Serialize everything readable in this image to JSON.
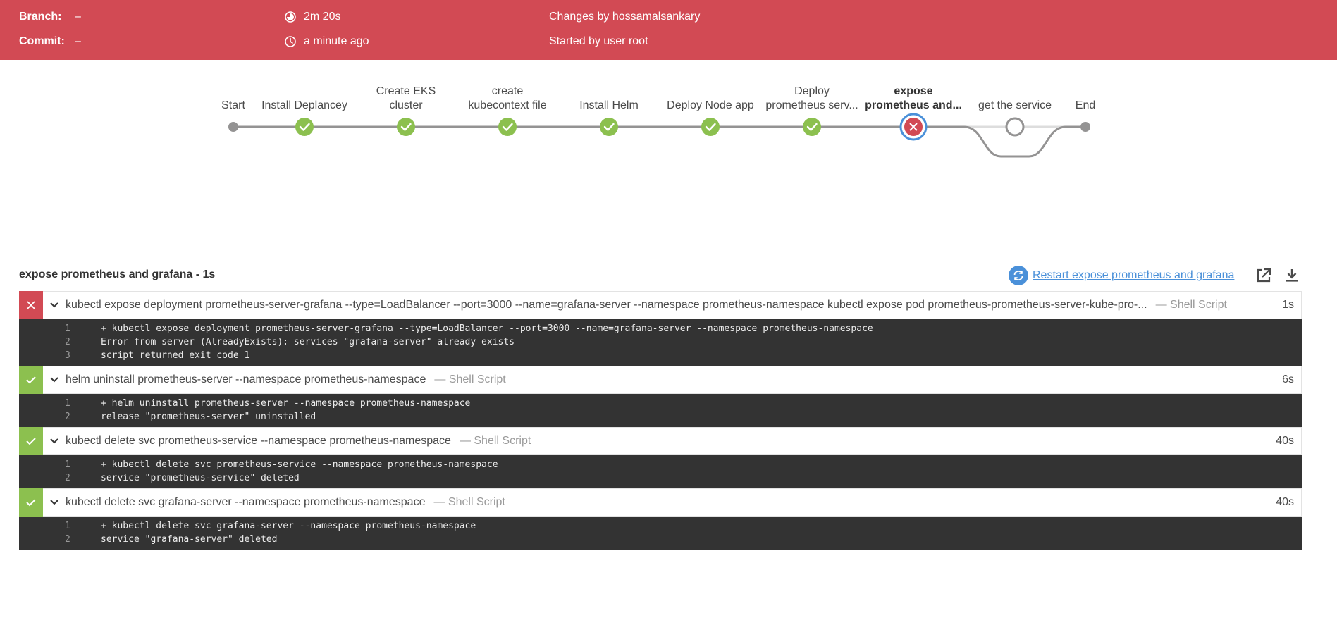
{
  "header": {
    "branch_label": "Branch:",
    "branch_value": "–",
    "commit_label": "Commit:",
    "commit_value": "–",
    "duration": "2m 20s",
    "started_ago": "a minute ago",
    "changes": "Changes by hossamalsankary",
    "started_by": "Started by user root",
    "background_color": "#d24a54"
  },
  "pipeline": {
    "stages": [
      {
        "label_lines": [
          "Start"
        ],
        "status": "node"
      },
      {
        "label_lines": [
          "Install Deplancey"
        ],
        "status": "success"
      },
      {
        "label_lines": [
          "Create EKS",
          "cluster"
        ],
        "status": "success"
      },
      {
        "label_lines": [
          "create",
          "kubecontext file"
        ],
        "status": "success"
      },
      {
        "label_lines": [
          "Install Helm"
        ],
        "status": "success"
      },
      {
        "label_lines": [
          "Deploy Node app"
        ],
        "status": "success"
      },
      {
        "label_lines": [
          "Deploy",
          "prometheus serv..."
        ],
        "status": "success"
      },
      {
        "label_lines": [
          "expose",
          "prometheus and..."
        ],
        "status": "failed",
        "selected": true
      },
      {
        "label_lines": [
          "get the service"
        ],
        "status": "not-run"
      },
      {
        "label_lines": [
          "End"
        ],
        "status": "node"
      }
    ],
    "colors": {
      "success": "#8cc04f",
      "failed": "#d24a54",
      "selected_ring": "#4a90d9",
      "line": "#949393"
    }
  },
  "log": {
    "title": "expose prometheus and grafana - 1s",
    "restart_label": "Restart expose prometheus and grafana",
    "steps": [
      {
        "status": "failed",
        "command": "kubectl expose deployment prometheus-server-grafana --type=LoadBalancer --port=3000 --name=grafana-server --namespace prometheus-namespace kubectl expose pod prometheus-prometheus-server-kube-pro-...",
        "type": "— Shell Script",
        "duration": "1s",
        "lines": [
          {
            "n": "1",
            "text": "+ kubectl expose deployment prometheus-server-grafana --type=LoadBalancer --port=3000 --name=grafana-server --namespace prometheus-namespace"
          },
          {
            "n": "2",
            "text": "Error from server (AlreadyExists): services \"grafana-server\" already exists"
          },
          {
            "n": "3",
            "text": "script returned exit code 1"
          }
        ]
      },
      {
        "status": "success",
        "command": "helm uninstall prometheus-server --namespace prometheus-namespace",
        "type": "— Shell Script",
        "duration": "6s",
        "lines": [
          {
            "n": "1",
            "text": "+ helm uninstall prometheus-server --namespace prometheus-namespace"
          },
          {
            "n": "2",
            "text": "release \"prometheus-server\" uninstalled"
          }
        ]
      },
      {
        "status": "success",
        "command": "kubectl delete svc prometheus-service --namespace prometheus-namespace",
        "type": "— Shell Script",
        "duration": "40s",
        "lines": [
          {
            "n": "1",
            "text": "+ kubectl delete svc prometheus-service --namespace prometheus-namespace"
          },
          {
            "n": "2",
            "text": "service \"prometheus-service\" deleted"
          }
        ]
      },
      {
        "status": "success",
        "command": "kubectl delete svc grafana-server --namespace prometheus-namespace",
        "type": "— Shell Script",
        "duration": "40s",
        "lines": [
          {
            "n": "1",
            "text": "+ kubectl delete svc grafana-server --namespace prometheus-namespace"
          },
          {
            "n": "2",
            "text": "service \"grafana-server\" deleted"
          }
        ]
      }
    ]
  }
}
